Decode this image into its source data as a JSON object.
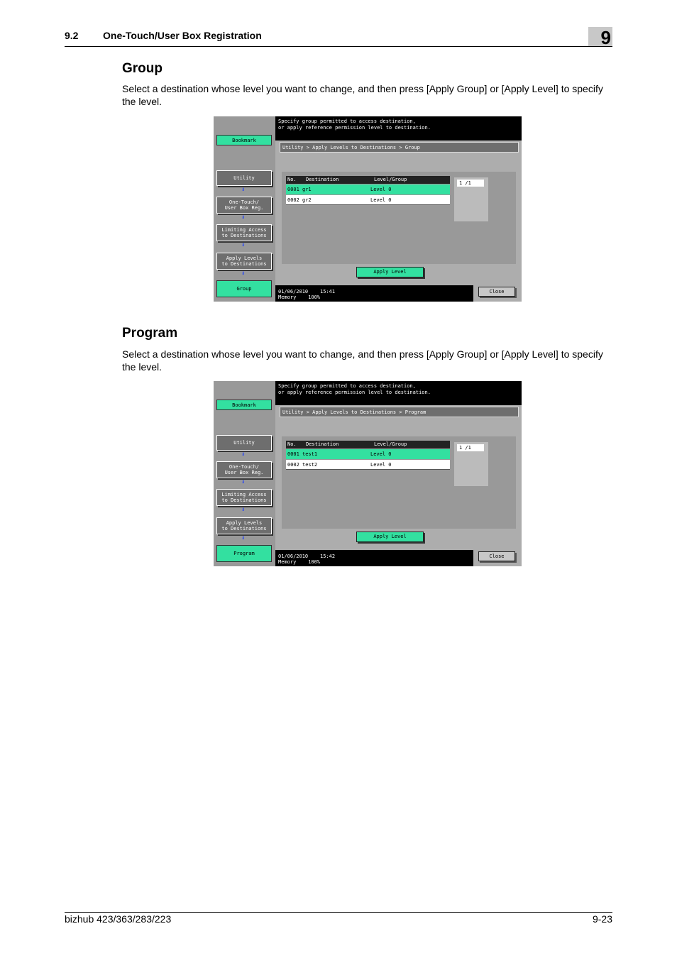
{
  "header": {
    "section_number": "9.2",
    "section_title": "One-Touch/User Box Registration",
    "chapter": "9"
  },
  "sections": [
    {
      "title": "Group",
      "text": "Select a destination whose level you want to change, and then press [Apply Group] or [Apply Level] to specify the level.",
      "screen": {
        "message_line1": "Specify group permitted to access destination,",
        "message_line2": "or apply reference permission level to destination.",
        "breadcrumb": "Utility > Apply Levels to Destinations > Group",
        "sidebar": {
          "bookmark": "Bookmark",
          "utility": "Utility",
          "onetouch_line1": "One-Touch/",
          "onetouch_line2": "User Box Reg.",
          "limiting_line1": "Limiting Access",
          "limiting_line2": "to Destinations",
          "apply_levels_line1": "Apply Levels",
          "apply_levels_line2": "to Destinations",
          "current": "Group"
        },
        "table_headers": [
          "No.",
          "Destination",
          "Level/Group"
        ],
        "rows": [
          {
            "no": "0001",
            "destination": "gr1",
            "level": "Level 0"
          },
          {
            "no": "0002",
            "destination": "gr2",
            "level": "Level 0"
          }
        ],
        "page_indicator": "1  /1",
        "apply_button": "Apply Level",
        "date": "01/06/2010",
        "time": "15:41",
        "memory_label": "Memory",
        "memory_value": "100%",
        "close_button": "Close"
      }
    },
    {
      "title": "Program",
      "text": "Select a destination whose level you want to change, and then press [Apply Group] or [Apply Level] to specify the level.",
      "screen": {
        "message_line1": "Specify group permitted to access destination,",
        "message_line2": "or apply reference permission level to destination.",
        "breadcrumb": "Utility > Apply Levels to Destinations > Program",
        "sidebar": {
          "bookmark": "Bookmark",
          "utility": "Utility",
          "onetouch_line1": "One-Touch/",
          "onetouch_line2": "User Box Reg.",
          "limiting_line1": "Limiting Access",
          "limiting_line2": "to Destinations",
          "apply_levels_line1": "Apply Levels",
          "apply_levels_line2": "to Destinations",
          "current": "Program"
        },
        "table_headers": [
          "No.",
          "Destination",
          "Level/Group"
        ],
        "rows": [
          {
            "no": "0001",
            "destination": "test1",
            "level": "Level 0"
          },
          {
            "no": "0002",
            "destination": "test2",
            "level": "Level 0"
          }
        ],
        "page_indicator": "1  /1",
        "apply_button": "Apply Level",
        "date": "01/06/2010",
        "time": "15:42",
        "memory_label": "Memory",
        "memory_value": "100%",
        "close_button": "Close"
      }
    }
  ],
  "footer": {
    "model": "bizhub 423/363/283/223",
    "page": "9-23"
  }
}
